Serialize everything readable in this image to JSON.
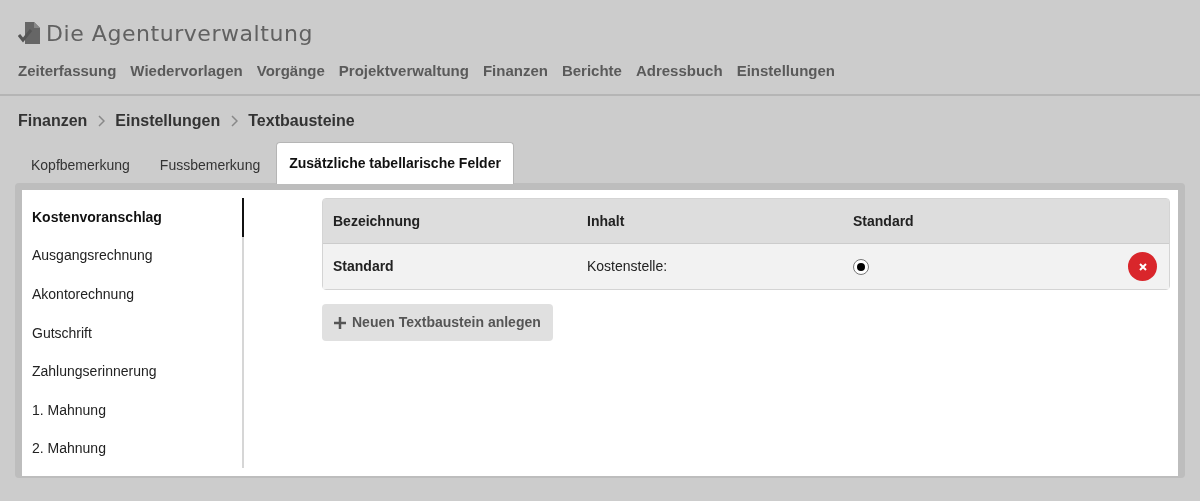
{
  "app": {
    "title": "Die Agenturverwaltung"
  },
  "nav": [
    {
      "label": "Zeiterfassung"
    },
    {
      "label": "Wiedervorlagen"
    },
    {
      "label": "Vorgänge"
    },
    {
      "label": "Projektverwaltung"
    },
    {
      "label": "Finanzen"
    },
    {
      "label": "Berichte"
    },
    {
      "label": "Adressbuch"
    },
    {
      "label": "Einstellungen"
    }
  ],
  "breadcrumb": [
    "Finanzen",
    "Einstellungen",
    "Textbausteine"
  ],
  "tabs": [
    {
      "label": "Kopfbemerkung",
      "selected": false
    },
    {
      "label": "Fussbemerkung",
      "selected": false
    },
    {
      "label": "Zusätzliche tabellarische Felder",
      "selected": true
    }
  ],
  "sidebar": {
    "items": [
      {
        "label": "Kostenvoranschlag",
        "selected": true
      },
      {
        "label": "Ausgangsrechnung",
        "selected": false
      },
      {
        "label": "Akontorechnung",
        "selected": false
      },
      {
        "label": "Gutschrift",
        "selected": false
      },
      {
        "label": "Zahlungserinnerung",
        "selected": false
      },
      {
        "label": "1. Mahnung",
        "selected": false
      },
      {
        "label": "2. Mahnung",
        "selected": false
      }
    ]
  },
  "table": {
    "columns": [
      "Bezeichnung",
      "Inhalt",
      "Standard"
    ],
    "rows": [
      {
        "bezeichnung": "Standard",
        "inhalt": "Kostenstelle:",
        "standard": true
      }
    ]
  },
  "add_button": {
    "label": "Neuen Textbaustein anlegen"
  }
}
